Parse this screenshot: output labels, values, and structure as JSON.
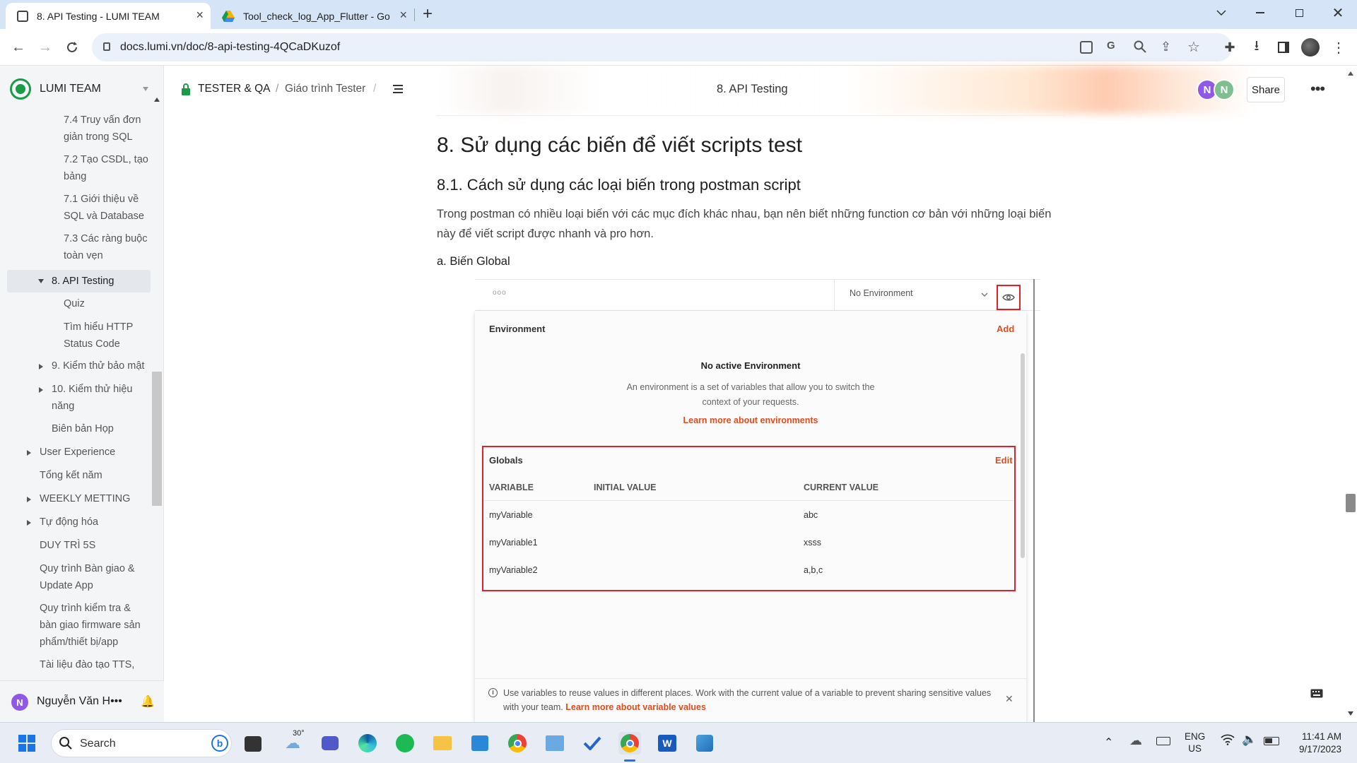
{
  "browser": {
    "tabs": [
      {
        "title": "8. API Testing - LUMI TEAM",
        "active": true
      },
      {
        "title": "Tool_check_log_App_Flutter - Go",
        "active": false
      }
    ],
    "url": "docs.lumi.vn/doc/8-api-testing-4QCaDKuzof"
  },
  "sidebar": {
    "team": "LUMI TEAM",
    "items": [
      {
        "label": "7.4 Truy vấn đơn giản trong SQL"
      },
      {
        "label": "7.2 Tạo CSDL, tạo bảng"
      },
      {
        "label": "7.1 Giới thiệu về SQL và Database"
      },
      {
        "label": "7.3 Các ràng buộc toàn vẹn"
      },
      {
        "label": "8. API Testing",
        "selected": true
      },
      {
        "label": "Quiz"
      },
      {
        "label": "Tìm hiểu HTTP Status Code"
      },
      {
        "label": "9. Kiểm thử bảo mật"
      },
      {
        "label": "10. Kiểm thử hiệu năng"
      },
      {
        "label": "Biên bản Họp"
      },
      {
        "label": "User Experience"
      },
      {
        "label": "Tổng kết năm"
      },
      {
        "label": "WEEKLY METTING"
      },
      {
        "label": "Tự động hóa"
      },
      {
        "label": "DUY TRÌ 5S"
      },
      {
        "label": "Quy trình Bàn giao & Update App"
      },
      {
        "label": "Quy trình kiểm tra & bàn giao firmware sản phẩm/thiết bị/app"
      },
      {
        "label": "Tài liệu đào tạo TTS,"
      }
    ],
    "user": {
      "initial": "N",
      "name": "Nguyễn Văn H•••"
    }
  },
  "header": {
    "breadcrumb": [
      "TESTER & QA",
      "Giáo trình Tester"
    ],
    "separator": "/",
    "title": "8. API Testing",
    "avatars": [
      "N",
      "N"
    ],
    "share_label": "Share"
  },
  "doc": {
    "h1": "8. Sử dụng các biến để viết scripts test",
    "h2": "8.1. Cách sử dụng các loại biến trong postman script",
    "para": "Trong postman có nhiều loại biến với các mục đích khác nhau, bạn nên biết những function cơ bản với những loại biến này để viết script được nhanh và pro hơn.",
    "h3": "a. Biến Global"
  },
  "postman": {
    "dots": "ooo",
    "env_select": "No Environment",
    "environment_label": "Environment",
    "add_label": "Add",
    "no_env_title": "No active Environment",
    "no_env_desc": "An environment is a set of variables that allow you to switch the context of your requests.",
    "learn_env": "Learn more about environments",
    "globals_label": "Globals",
    "edit_label": "Edit",
    "columns": [
      "VARIABLE",
      "INITIAL VALUE",
      "CURRENT VALUE"
    ],
    "rows": [
      {
        "variable": "myVariable",
        "initial": "",
        "current": "abc"
      },
      {
        "variable": "myVariable1",
        "initial": "",
        "current": "xsss"
      },
      {
        "variable": "myVariable2",
        "initial": "",
        "current": "a,b,c"
      }
    ],
    "notice": "Use variables to reuse values in different places. Work with the current value of a variable to prevent sharing sensitive values with your team.",
    "notice_link": "Learn more about variable values"
  },
  "taskbar": {
    "search_placeholder": "Search",
    "weather": "30°",
    "lang_top": "ENG",
    "lang_bottom": "US",
    "time": "11:41 AM",
    "date": "9/17/2023"
  },
  "colors": {
    "accent_red": "#e0202a",
    "link_orange": "#e5491b",
    "brand_green": "#1b9a48",
    "avatar_purple": "#8f59e6",
    "avatar_green": "#7fbf8f"
  }
}
